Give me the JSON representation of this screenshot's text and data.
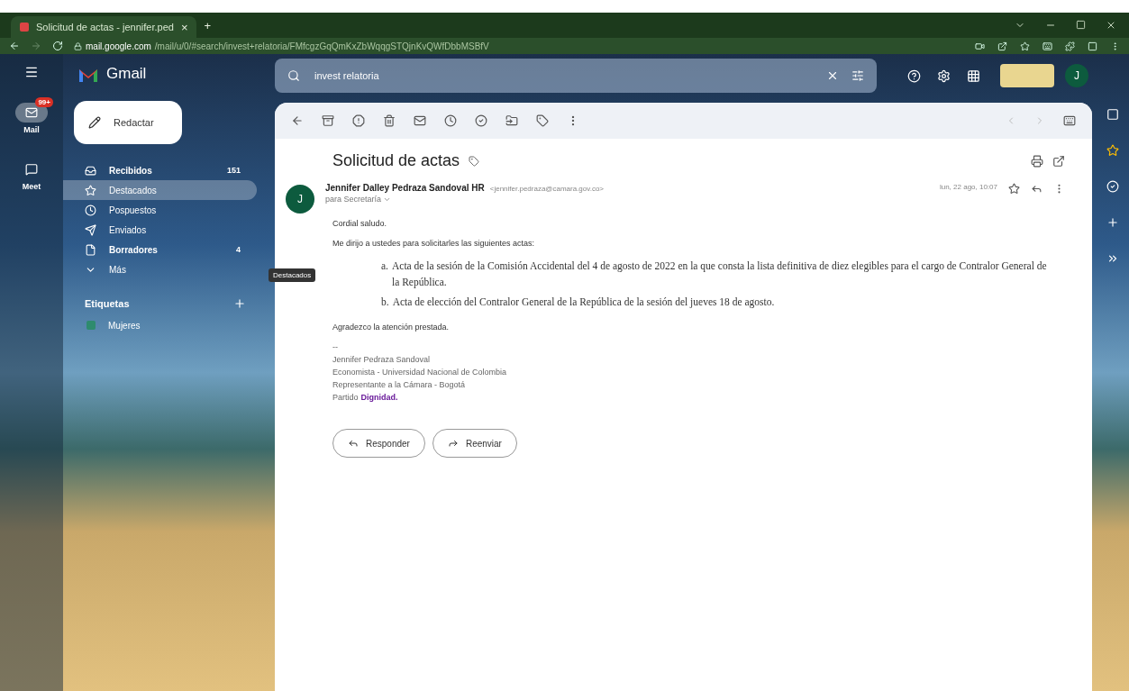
{
  "browser": {
    "tab_title": "Solicitud de actas - jennifer.ped",
    "tab_close": "×",
    "new_tab": "+",
    "url_host": "mail.google.com",
    "url_path": "/mail/u/0/#search/invest+relatoria/FMfcgzGqQmKxZbWqqgSTQjnKvQWfDbbMSBfV"
  },
  "rail": [
    {
      "label": "Mail",
      "badge": "99+",
      "selected": true
    },
    {
      "label": "Meet",
      "selected": false
    }
  ],
  "app_name": "Gmail",
  "compose": "Redactar",
  "nav": [
    {
      "label": "Recibidos",
      "count": "151",
      "bold": true,
      "selected": false
    },
    {
      "label": "Destacados",
      "selected": true,
      "bold": false
    },
    {
      "label": "Pospuestos",
      "selected": false,
      "bold": false
    },
    {
      "label": "Enviados",
      "selected": false,
      "bold": false
    },
    {
      "label": "Borradores",
      "count": "4",
      "bold": true,
      "selected": false
    },
    {
      "label": "Más",
      "selected": false,
      "bold": false
    }
  ],
  "labels_heading": "Etiquetas",
  "labels": [
    {
      "label": "Mujeres",
      "color": "#2e8b6e"
    }
  ],
  "tooltip": "Destacados",
  "search": {
    "value": "invest relatoria"
  },
  "email": {
    "subject": "Solicitud de actas",
    "sender": "Jennifer Dalley Pedraza Sandoval HR",
    "sender_address": "<jennifer.pedraza@camara.gov.co>",
    "recipient": "para Secretaría",
    "date": "lun, 22 ago, 10:07",
    "avatar": "J",
    "greeting": "Cordial saludo.",
    "intro": "Me dirijo a ustedes para solicitarles las siguientes actas:",
    "items": [
      {
        "marker": "a.",
        "text": "Acta de la sesión de la Comisión Accidental del 4 de agosto de 2022 en la que consta la lista definitiva de diez elegibles para el cargo de Contralor General de la República."
      },
      {
        "marker": "b.",
        "text": "Acta de elección del Contralor General de la República de la sesión del jueves 18 de agosto."
      }
    ],
    "thanks": "Agradezco la atención prestada.",
    "separator": "--",
    "signature": [
      "Jennifer Pedraza Sandoval",
      "Economista - Universidad Nacional de Colombia",
      "Representante a la Cámara - Bogotá"
    ],
    "party_label": "Partido",
    "party_link": "Dignidad."
  },
  "actions": [
    "Responder",
    "Reenviar"
  ],
  "profile_initial": "J"
}
